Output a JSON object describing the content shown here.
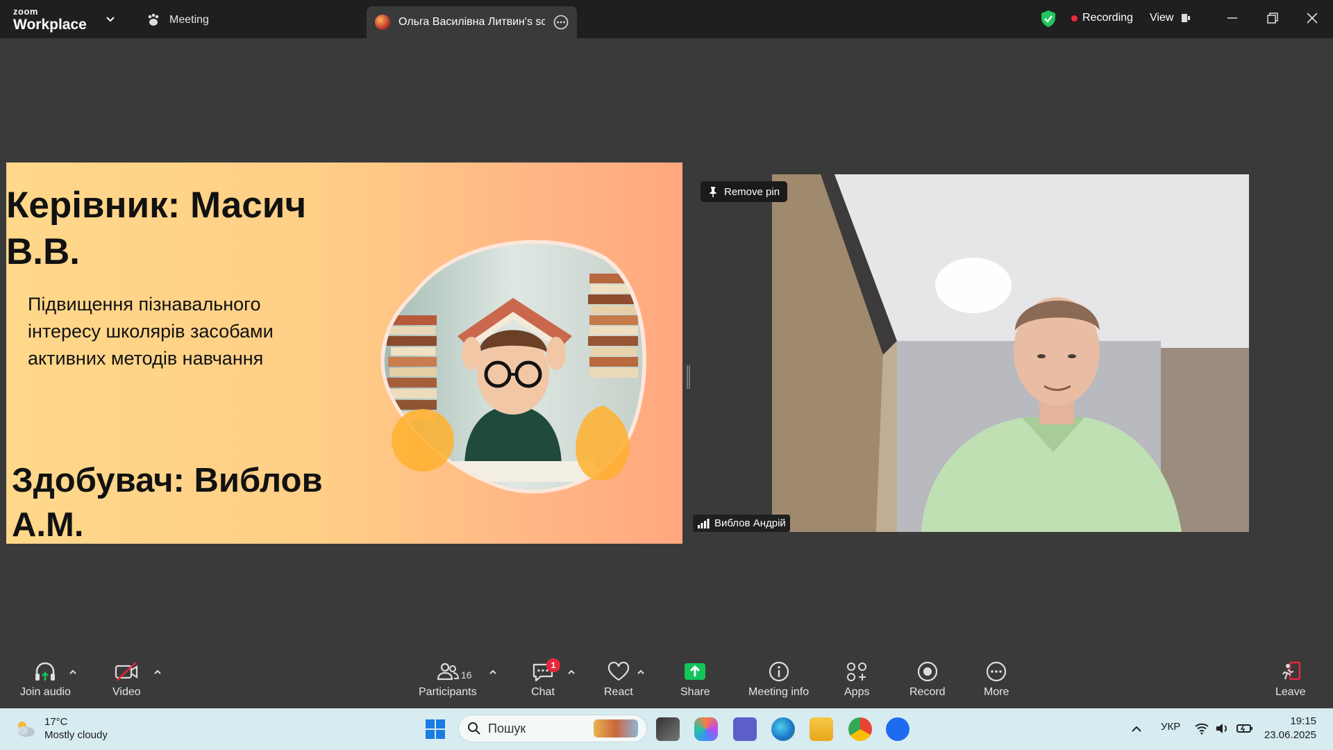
{
  "titlebar": {
    "brand_top": "zoom",
    "brand_bottom": "Workplace",
    "meeting_tab": "Meeting",
    "share_tab": "Ольга Василівна Литвин's screen",
    "recording": "Recording",
    "view": "View"
  },
  "slide": {
    "supervisor": "Керівник: Масич В.В.",
    "topic": "Підвищення пізнавального інтересу школярів засобами активних методів навчання",
    "applicant": "Здобувач: Виблов А.М."
  },
  "video": {
    "remove_pin": "Remove pin",
    "participant_name": "Виблов  Андрій"
  },
  "toolbar": {
    "join_audio": "Join audio",
    "video": "Video",
    "participants": "Participants",
    "participants_count": "16",
    "chat": "Chat",
    "chat_badge": "1",
    "react": "React",
    "share": "Share",
    "meeting_info": "Meeting info",
    "apps": "Apps",
    "record": "Record",
    "more": "More",
    "leave": "Leave"
  },
  "taskbar": {
    "temperature": "17°C",
    "weather": "Mostly cloudy",
    "search_placeholder": "Пошук",
    "language": "УКР",
    "time": "19:15",
    "date": "23.06.2025"
  },
  "colors": {
    "accent_green": "#12c45a",
    "record_red": "#ee2b3a",
    "badge_red": "#e8273b",
    "shield_green": "#22c55e"
  }
}
